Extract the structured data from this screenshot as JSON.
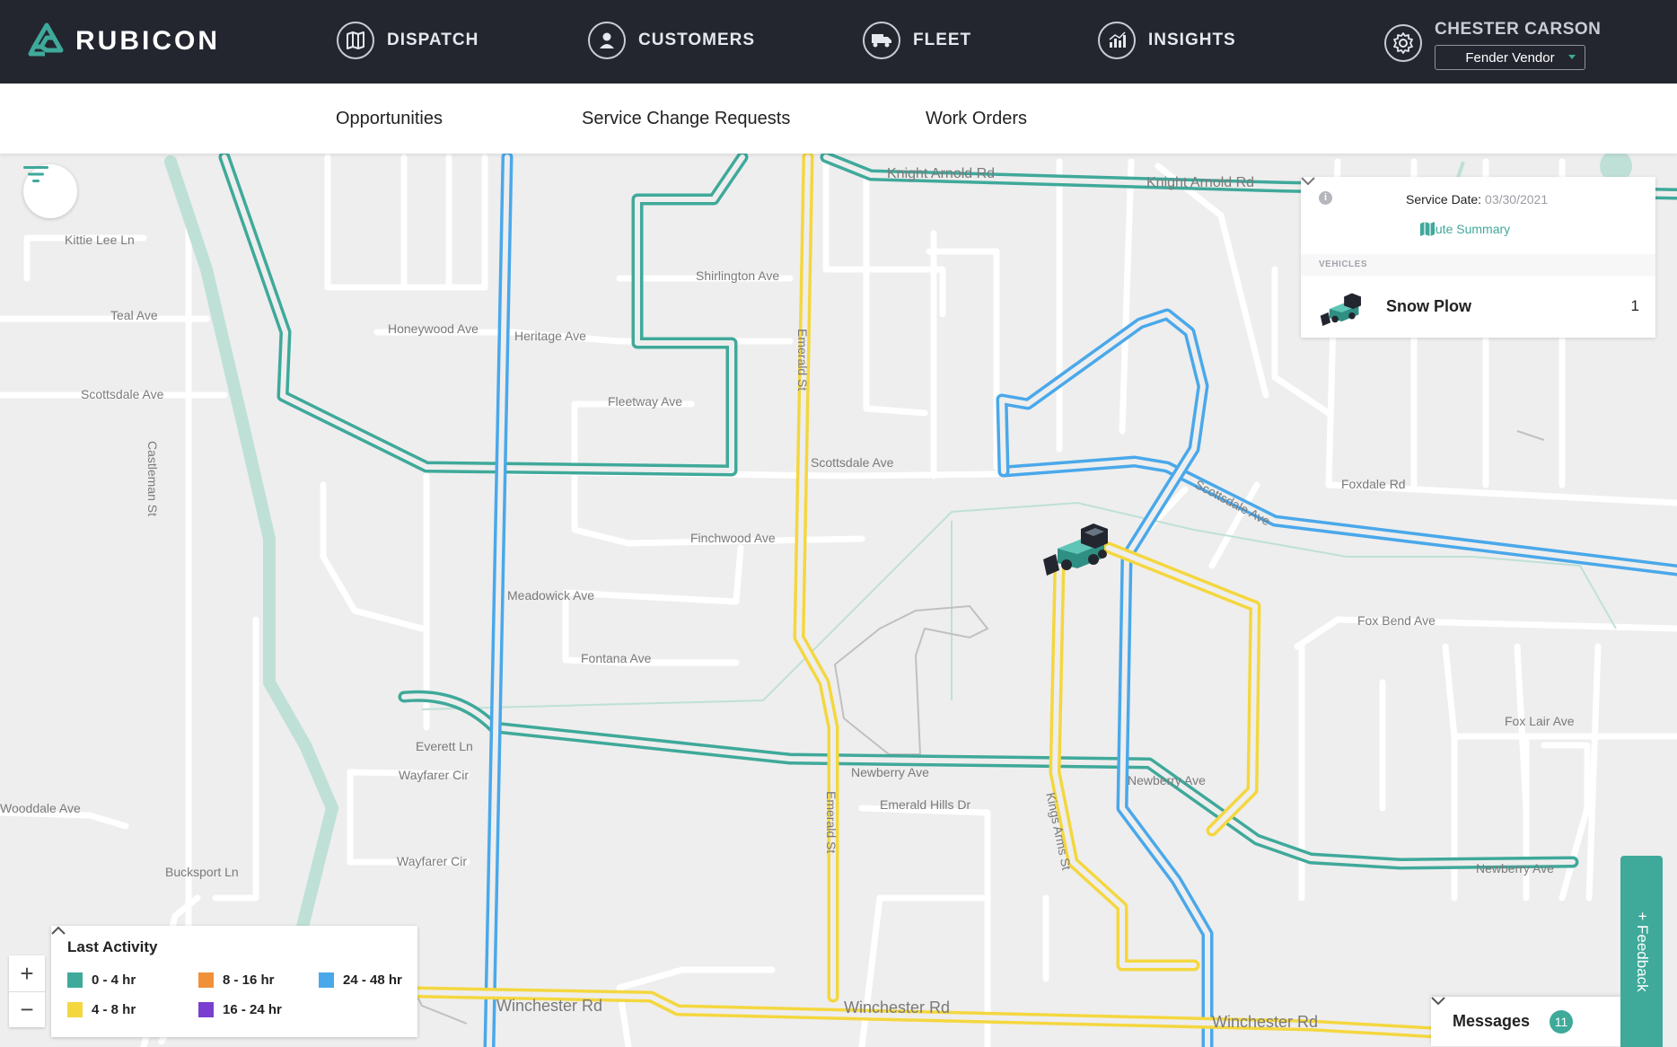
{
  "brand": {
    "name": "RUBICON"
  },
  "nav": {
    "items": [
      {
        "label": "DISPATCH",
        "icon": "map-icon"
      },
      {
        "label": "CUSTOMERS",
        "icon": "user-icon"
      },
      {
        "label": "FLEET",
        "icon": "truck-icon"
      },
      {
        "label": "INSIGHTS",
        "icon": "bar-chart-icon"
      }
    ]
  },
  "user": {
    "name": "CHESTER CARSON",
    "vendor": "Fender Vendor"
  },
  "subnav": {
    "items": [
      {
        "label": "Opportunities"
      },
      {
        "label": "Service Change Requests"
      },
      {
        "label": "Work Orders"
      }
    ]
  },
  "panel": {
    "service_date_label": "Service Date:",
    "service_date_value": "03/30/2021",
    "route_summary": "Route Summary",
    "vehicles_heading": "VEHICLES",
    "vehicle": {
      "name": "Snow Plow",
      "count": "1"
    }
  },
  "legend": {
    "title": "Last Activity",
    "items": [
      {
        "label": "0 - 4 hr",
        "color": "#3fa99a"
      },
      {
        "label": "4 - 8 hr",
        "color": "#f4d73f"
      },
      {
        "label": "8 - 16 hr",
        "color": "#f0913a"
      },
      {
        "label": "16 - 24 hr",
        "color": "#7b3fd0"
      },
      {
        "label": "24 - 48 hr",
        "color": "#4aa8ea"
      }
    ]
  },
  "messages": {
    "label": "Messages",
    "count": "11"
  },
  "feedback": {
    "label": "+ Feedback"
  },
  "zoom": {
    "in": "+",
    "out": "−"
  },
  "streets": [
    "Kittie Lee Ln",
    "Teal Ave",
    "Scottsdale Ave",
    "Castleman St",
    "Honeywood Ave",
    "Heritage Ave",
    "Shirlington Ave",
    "Fleetway Ave",
    "Scottsdale Ave",
    "Finchwood Ave",
    "Meadowick Ave",
    "Fontana Ave",
    "Everett Ln",
    "Wayfarer Cir",
    "Wayfarer Cir",
    "Bucksport Ln",
    "Wooddale Ave",
    "Winchester Rd",
    "Winchester Rd",
    "Winchester Rd",
    "Knight Arnold Rd",
    "Knight Arnold Rd",
    "Foxdale Rd",
    "Fox Bend Ave",
    "Fox Lair Ave",
    "Emerald Hills Dr",
    "Newberry Ave",
    "Scottsdale Ave",
    "Newberry Ave",
    "Newberry Ave",
    "Emerald St",
    "Emerald St",
    "Kings Arms St"
  ],
  "colors": {
    "nav_bg": "#23262f",
    "accent": "#3fa99a",
    "route_teal": "#3fa99a",
    "route_yellow": "#f4d73f",
    "route_blue": "#4aa8ea"
  }
}
